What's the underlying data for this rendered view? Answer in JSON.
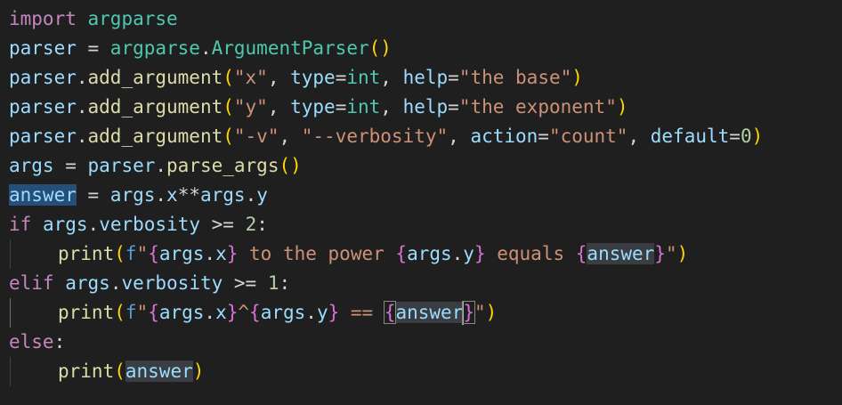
{
  "editor": {
    "language": "python",
    "theme_background": "#1f1f1f",
    "lines": [
      "import argparse",
      "parser = argparse.ArgumentParser()",
      "parser.add_argument(\"x\", type=int, help=\"the base\")",
      "parser.add_argument(\"y\", type=int, help=\"the exponent\")",
      "parser.add_argument(\"-v\", \"--verbosity\", action=\"count\", default=0)",
      "args = parser.parse_args()",
      "answer = args.x**args.y",
      "if args.verbosity >= 2:",
      "    print(f\"{args.x} to the power {args.y} equals {answer}\")",
      "elif args.verbosity >= 1:",
      "    print(f\"{args.x}^{args.y} == {answer}\")",
      "else:",
      "    print(answer)"
    ],
    "selected_word": "answer",
    "cursor_line": 11
  },
  "tokens": {
    "import": "import",
    "argparse": "argparse",
    "parser": "parser",
    "eq": " = ",
    "dot": ".",
    "ArgumentParser": "ArgumentParser",
    "add_argument": "add_argument",
    "lparen": "(",
    "rparen": ")",
    "str_x": "\"x\"",
    "str_y": "\"y\"",
    "comma_sp": ", ",
    "type": "type",
    "eq_nosp": "=",
    "int": "int",
    "help": "help",
    "str_base": "\"the base\"",
    "str_exponent": "\"the exponent\"",
    "str_v": "\"-v\"",
    "str_verbosity": "\"--verbosity\"",
    "action": "action",
    "str_count": "\"count\"",
    "default": "default",
    "zero": "0",
    "args": "args",
    "parse_args": "parse_args",
    "answer": "answer",
    "x": "x",
    "pow": "**",
    "y": "y",
    "if": "if",
    "verbosity": "verbosity",
    "gte": " >= ",
    "two": "2",
    "one": "1",
    "colon": ":",
    "print": "print",
    "f": "f",
    "quote": "\"",
    "lbrace": "{",
    "rbrace": "}",
    "sp_to_the_power_sp": " to the power ",
    "sp_equals_sp": " equals ",
    "caret": "^",
    "sp_eqeq_sp": " == ",
    "elif": "elif",
    "else": "else",
    "sp": " "
  }
}
